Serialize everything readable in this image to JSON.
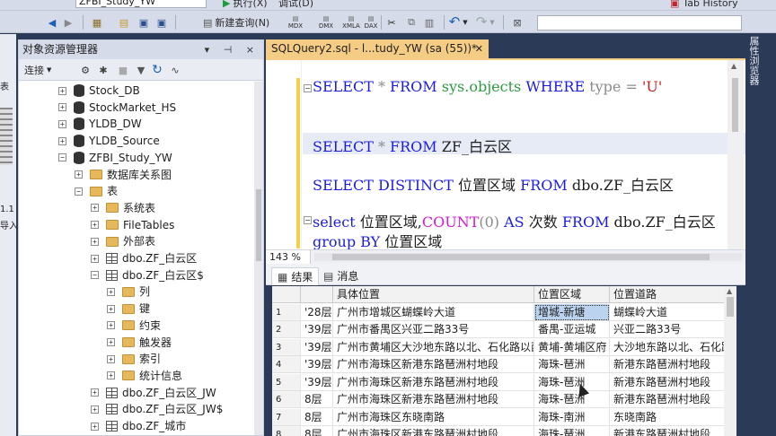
{
  "toolbar": {
    "db_combo": "ZFBI_Study_YW",
    "execute": "执行(X)",
    "debug": "调试(D)",
    "new_query": "新建查询(N)",
    "tab_history": "Tab History",
    "mdx": "MDX",
    "dmx": "DMX",
    "xmla": "XMLA",
    "dax": "DAX"
  },
  "sliver": {
    "t1": "表",
    "t2": "1.1",
    "t3": "导入"
  },
  "object_explorer": {
    "title": "对象资源管理器",
    "pin_buttons": "▾ ⊣ ×",
    "connect": "连接",
    "tree": [
      {
        "label": "Stock_DB",
        "icon": "database"
      },
      {
        "label": "StockMarket_HS",
        "icon": "database"
      },
      {
        "label": "YLDB_DW",
        "icon": "database"
      },
      {
        "label": "YLDB_Source",
        "icon": "database"
      },
      {
        "label": "ZFBI_Study_YW",
        "icon": "database"
      },
      {
        "label": "数据库关系图",
        "icon": "folder"
      },
      {
        "label": "表",
        "icon": "folder"
      },
      {
        "label": "系统表",
        "icon": "folder"
      },
      {
        "label": "FileTables",
        "icon": "folder"
      },
      {
        "label": "外部表",
        "icon": "folder"
      },
      {
        "label": "dbo.ZF_白云区",
        "icon": "table"
      },
      {
        "label": "dbo.ZF_白云区$",
        "icon": "table"
      },
      {
        "label": "列",
        "icon": "folder"
      },
      {
        "label": "键",
        "icon": "folder"
      },
      {
        "label": "约束",
        "icon": "folder"
      },
      {
        "label": "触发器",
        "icon": "folder"
      },
      {
        "label": "索引",
        "icon": "folder"
      },
      {
        "label": "统计信息",
        "icon": "folder"
      },
      {
        "label": "dbo.ZF_白云区_JW",
        "icon": "table"
      },
      {
        "label": "dbo.ZF_白云区_JW$",
        "icon": "table"
      },
      {
        "label": "dbo.ZF_城市",
        "icon": "table"
      }
    ]
  },
  "editor": {
    "tab_label": "SQLQuery2.sql - l...tudy_YW (sa (55))*",
    "tab_close": "✕",
    "zoom": "143 %",
    "lines": {
      "l1_kw1": "SELECT",
      "l1_star": " * ",
      "l1_kw2": "FROM",
      "l1_obj": " sys.objects ",
      "l1_kw3": "WHERE",
      "l1_col": " type = ",
      "l1_str": "'U'",
      "l2_kw1": "SELECT",
      "l2_star": " * ",
      "l2_kw2": "FROM",
      "l2_rest": " ZF_白云区",
      "l3_kw1": "SELECT DISTINCT",
      "l3_mid": " 位置区域 ",
      "l3_kw2": "FROM",
      "l3_rest": " dbo.ZF_白云区",
      "l4_kw1": "select",
      "l4_mid": " 位置区域,",
      "l4_fn": "COUNT",
      "l4_p": "(0) ",
      "l4_kw2": "AS",
      "l4_alias": " 次数 ",
      "l4_kw3": "FROM",
      "l4_rest": " dbo.ZF_白云区",
      "l5_kw1": "group BY",
      "l5_rest": " 位置区域"
    }
  },
  "results": {
    "tab_results": "结果",
    "tab_messages": "消息",
    "columns": [
      "",
      "具体位置",
      "位置区域",
      "位置道路"
    ],
    "rows": [
      [
        "1",
        "'28层",
        "广州市增城区蝴蝶岭大道",
        "增城-新塘",
        "蝴蝶岭大道"
      ],
      [
        "2",
        "'39层",
        "广州市番禺区兴亚二路33号",
        "番禺-亚运城",
        "兴亚二路33号"
      ],
      [
        "3",
        "'39层",
        "广州市黄埔区大沙地东路以北、石化路以西",
        "黄埔-黄埔区府",
        "大沙地东路以北、石化路"
      ],
      [
        "4",
        "'39层",
        "广州市海珠区新港东路琶洲村地段",
        "海珠-琶洲",
        "新港东路琶洲村地段"
      ],
      [
        "5",
        "'39层",
        "广州市海珠区新港东路琶洲村地段",
        "海珠-琶洲",
        "新港东路琶洲村地段"
      ],
      [
        "6",
        "8层",
        "广州市海珠区新港东路琶洲村地段",
        "海珠-琶洲",
        "新港东路琶洲村地段"
      ],
      [
        "7",
        "8层",
        "广州市海珠区东晓南路",
        "海珠-南洲",
        "东晓南路"
      ],
      [
        "8",
        "8层",
        "广州市海珠区新港东路琶洲村地段",
        "海珠-琶洲",
        "新港东路琶洲村地段"
      ]
    ]
  },
  "right_pane": {
    "label": "属性浏览器"
  }
}
